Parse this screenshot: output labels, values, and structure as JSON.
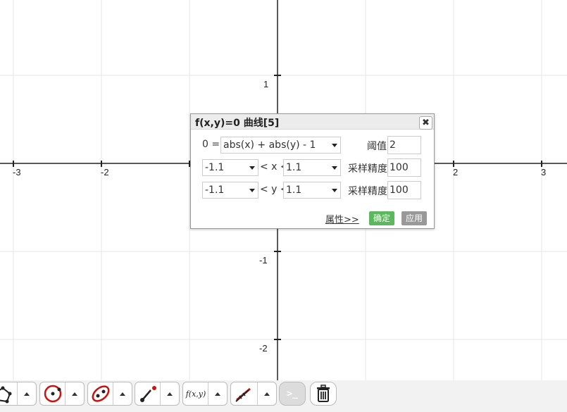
{
  "graph": {
    "x_ticks": [
      "-3",
      "-2",
      "2",
      "3"
    ],
    "y_ticks": [
      "1",
      "-1",
      "-2"
    ]
  },
  "dialog": {
    "title": "f(x,y)=0 曲线[5]",
    "close": "✖",
    "equation_prefix": "0 =",
    "equation": "abs(x) + abs(y) - 1",
    "threshold_label": "阈值",
    "threshold_value": "2",
    "x_min": "-1.1",
    "x_mid": "< x <",
    "x_max": "1.1",
    "x_precision_label": "采样精度",
    "x_precision": "100",
    "y_min": "-1.1",
    "y_mid": "< y <",
    "y_max": "1.1",
    "y_precision_label": "采样精度",
    "y_precision": "100",
    "properties_link": "属性>>",
    "ok_button": "确定",
    "apply_button": "应用"
  },
  "toolbar": {
    "function_tool_label": "f(x,y)",
    "console_label": ">_"
  },
  "colors": {
    "grid": "#e6e6e6",
    "axis": "#222222",
    "ok": "#5cb85c",
    "apply": "#999999",
    "accent_red": "#cc1111"
  }
}
